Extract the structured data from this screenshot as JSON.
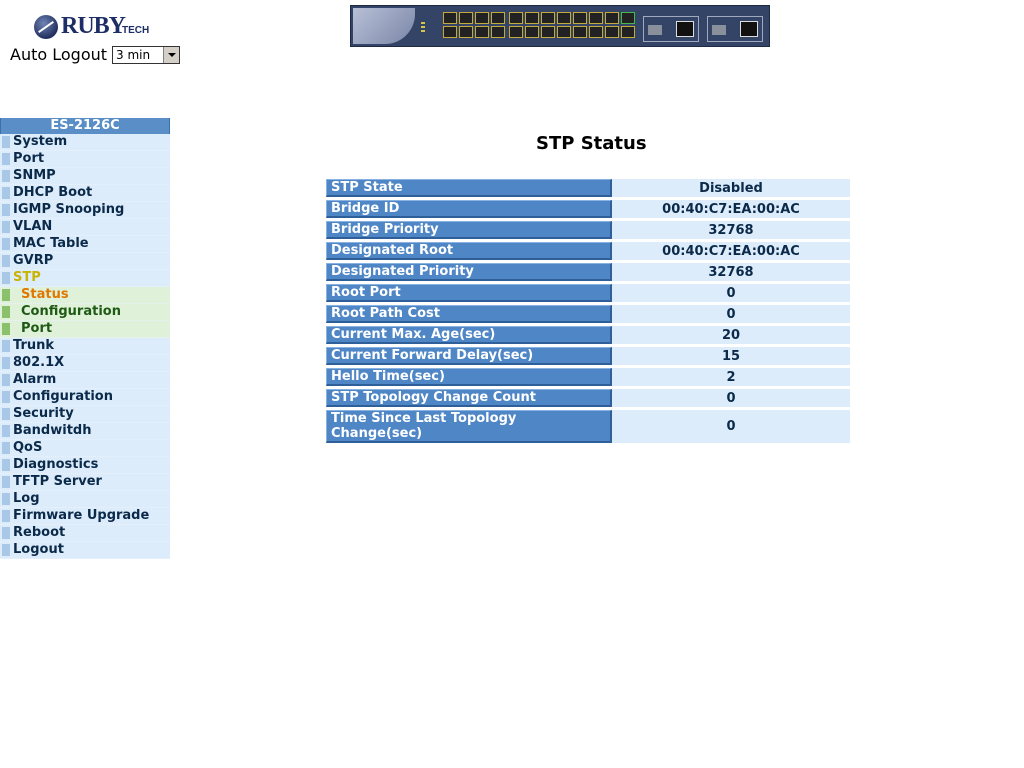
{
  "brand": {
    "logo_word": "RUBY",
    "logo_sub": "TECH"
  },
  "auto_logout": {
    "label": "Auto Logout",
    "value": "3 min"
  },
  "sidebar": {
    "device": "ES-2126C",
    "items": [
      {
        "label": "System"
      },
      {
        "label": "Port"
      },
      {
        "label": "SNMP"
      },
      {
        "label": "DHCP Boot"
      },
      {
        "label": "IGMP Snooping"
      },
      {
        "label": "VLAN"
      },
      {
        "label": "MAC Table"
      },
      {
        "label": "GVRP"
      },
      {
        "label": "STP"
      },
      {
        "label": "Status"
      },
      {
        "label": "Configuration"
      },
      {
        "label": "Port"
      },
      {
        "label": "Trunk"
      },
      {
        "label": "802.1X"
      },
      {
        "label": "Alarm"
      },
      {
        "label": "Configuration"
      },
      {
        "label": "Security"
      },
      {
        "label": "Bandwitdh"
      },
      {
        "label": "QoS"
      },
      {
        "label": "Diagnostics"
      },
      {
        "label": "TFTP Server"
      },
      {
        "label": "Log"
      },
      {
        "label": "Firmware Upgrade"
      },
      {
        "label": "Reboot"
      },
      {
        "label": "Logout"
      }
    ]
  },
  "main": {
    "title": "STP Status",
    "rows": [
      {
        "key": "STP State",
        "value": "Disabled"
      },
      {
        "key": "Bridge ID",
        "value": "00:40:C7:EA:00:AC"
      },
      {
        "key": "Bridge Priority",
        "value": "32768"
      },
      {
        "key": "Designated Root",
        "value": "00:40:C7:EA:00:AC"
      },
      {
        "key": "Designated Priority",
        "value": "32768"
      },
      {
        "key": "Root Port",
        "value": "0"
      },
      {
        "key": "Root Path Cost",
        "value": "0"
      },
      {
        "key": "Current Max. Age(sec)",
        "value": "20"
      },
      {
        "key": "Current Forward Delay(sec)",
        "value": "15"
      },
      {
        "key": "Hello Time(sec)",
        "value": "2"
      },
      {
        "key": "STP Topology Change Count",
        "value": "0"
      },
      {
        "key": "Time Since Last Topology Change(sec)",
        "value": "0"
      }
    ]
  }
}
